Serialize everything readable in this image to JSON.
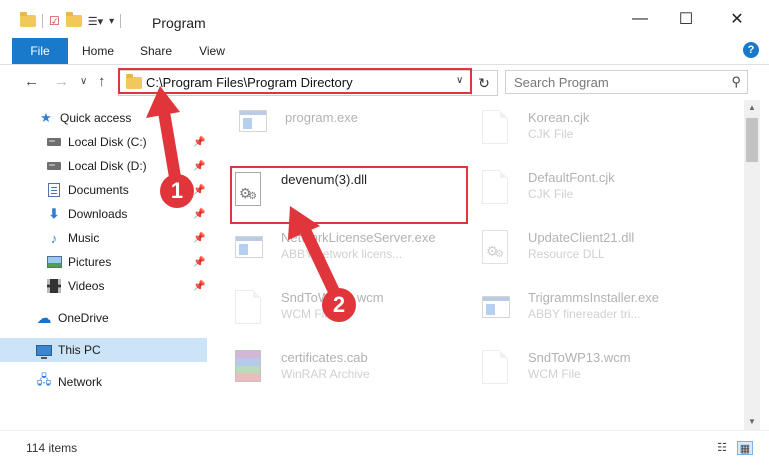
{
  "window": {
    "title": "Program",
    "minimize_glyph": "—",
    "maximize_glyph": "☐",
    "close_glyph": "✕"
  },
  "ribbon": {
    "tabs": [
      {
        "label": "File"
      },
      {
        "label": "Home"
      },
      {
        "label": "Share"
      },
      {
        "label": "View"
      }
    ],
    "help_glyph": "?"
  },
  "address": {
    "path": "C:\\Program Files\\Program Directory",
    "dropdown_glyph": "∨",
    "refresh_glyph": "↻"
  },
  "search": {
    "placeholder": "Search Program",
    "icon_glyph": "⚲"
  },
  "navigation": {
    "back_glyph": "←",
    "forward_glyph": "→",
    "recent_glyph": "∨",
    "up_glyph": "↑"
  },
  "sidebar": {
    "items": [
      {
        "label": "Quick access",
        "icon": "star-icon",
        "pinned": false
      },
      {
        "label": "Local Disk (C:)",
        "icon": "drive-icon",
        "pinned": true
      },
      {
        "label": "Local Disk (D:)",
        "icon": "drive-icon",
        "pinned": true
      },
      {
        "label": "Documents",
        "icon": "documents-icon",
        "pinned": true
      },
      {
        "label": "Downloads",
        "icon": "download-icon",
        "pinned": true
      },
      {
        "label": "Music",
        "icon": "music-icon",
        "pinned": true
      },
      {
        "label": "Pictures",
        "icon": "pictures-icon",
        "pinned": true
      },
      {
        "label": "Videos",
        "icon": "videos-icon",
        "pinned": true
      },
      {
        "label": "OneDrive",
        "icon": "cloud-icon",
        "pinned": false
      },
      {
        "label": "This PC",
        "icon": "computer-icon",
        "pinned": false,
        "selected": true
      },
      {
        "label": "Network",
        "icon": "network-icon",
        "pinned": false
      }
    ],
    "pin_glyph": "📌"
  },
  "files": [
    {
      "name": "program.exe",
      "type": "",
      "icon": "installer-icon",
      "faded": true
    },
    {
      "name": "Korean.cjk",
      "type": "CJK File",
      "icon": "generic-file-icon",
      "faded": true
    },
    {
      "name": "devenum(3).dll",
      "type": "",
      "icon": "dll-file-icon",
      "faded": false,
      "highlighted": true
    },
    {
      "name": "DefaultFont.cjk",
      "type": "CJK File",
      "icon": "generic-file-icon",
      "faded": true
    },
    {
      "name": "NetworkLicenseServer.exe",
      "type": "ABBY network licens...",
      "icon": "app-icon",
      "faded": true
    },
    {
      "name": "UpdateClient21.dll",
      "type": "Resource DLL",
      "icon": "dll-file-icon",
      "faded": true
    },
    {
      "name": "SndToWP13.wcm",
      "type": "WCM File",
      "icon": "generic-file-icon",
      "faded": true
    },
    {
      "name": "TrigrammsInstaller.exe",
      "type": "ABBY finereader tri...",
      "icon": "app-icon",
      "faded": true
    },
    {
      "name": "certificates.cab",
      "type": "WinRAR Archive",
      "icon": "archive-icon",
      "faded": true
    },
    {
      "name": "SndToWP13.wcm",
      "type": "WCM File",
      "icon": "generic-file-icon",
      "faded": true
    }
  ],
  "callouts": [
    {
      "number": "1",
      "color": "#e0353a"
    },
    {
      "number": "2",
      "color": "#e0353a"
    }
  ],
  "status": {
    "item_count": "114 items"
  },
  "colors": {
    "accent": "#1979ca",
    "highlight": "#e0353a",
    "selected_bg": "#cce4f7"
  }
}
